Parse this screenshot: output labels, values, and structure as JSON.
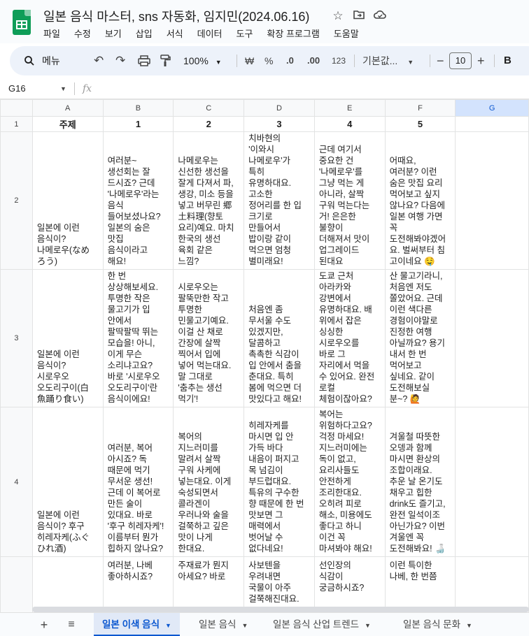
{
  "window": {
    "doc_title": "일본 음식 마스터, sns 자동화, 임지민(2024.06.16)",
    "title_icons": [
      "star-icon",
      "move-to-folder-icon",
      "cloud-status-icon"
    ]
  },
  "menu": [
    "파일",
    "수정",
    "보기",
    "삽입",
    "서식",
    "데이터",
    "도구",
    "확장 프로그램",
    "도움말"
  ],
  "toolbar": {
    "search_label": "메뉴",
    "zoom": "100%",
    "currency": "₩",
    "percent": "%",
    "decrease_decimal": ".0",
    "increase_decimal": ".00",
    "number_format": "123",
    "font": "기본값...",
    "font_size": "10",
    "plus": "+",
    "bold": "B"
  },
  "formula_bar": {
    "cell_ref": "G16",
    "fx": "fx",
    "value": ""
  },
  "columns": [
    "A",
    "B",
    "C",
    "D",
    "E",
    "F",
    "G"
  ],
  "rows": [
    {
      "num": "1",
      "cells": [
        "주제",
        "1",
        "2",
        "3",
        "4",
        "5",
        ""
      ]
    },
    {
      "num": "2",
      "cells": [
        "일본에 이런\n음식이?\n나메로우(なめ\nろう)",
        "여러분~\n생선회는 잘\n드시죠? 근데\n'나메로우'라는\n음식\n들어보셨나요?\n일본의 숨은\n맛집\n음식이라고\n해요!",
        "나메로우는\n신선한 생선을\n잘게 다져서 파,\n생강, 미소 등을\n넣고 버무린 郷\n土料理(향토\n요리)예요. 마치\n한국의 생선\n육회 같은\n느낌?",
        "치바현의\n'이와시\n나메로우'가\n특히\n유명하대요.\n고소한\n정어리를 한 입\n크기로\n만들어서\n밥이랑 같이\n먹으면 엄청\n별미래요!",
        "근데 여기서\n중요한 건\n'나메로우'를\n그냥 먹는 게\n아니라, 살짝\n구워 먹는다는\n거! 은은한\n불향이\n더해져서 맛이\n업그레이드\n된대요",
        "어때요,\n여러분? 이런\n숨은 맛집 요리\n먹어보고 싶지\n않나요? 다음에\n일본 여행 가면\n꼭\n도전해봐야겠어\n요. 벌써부터 침\n고이네요 🤤",
        ""
      ]
    },
    {
      "num": "3",
      "cells": [
        "일본에 이런\n음식이?\n시로우오\n오도리구이(白\n魚踊り食い)",
        "한 번\n상상해보세요.\n투명한 작은\n물고기가 입\n안에서\n팔딱팔딱 뛰는\n모습을! 아니,\n이게 무슨\n소리냐고요?\n바로 '시로우오\n오도리구이'란\n음식이에요!",
        "시로우오는\n팔뚝만한 작고\n투명한\n민물고기예요.\n이걸 산 채로\n간장에 살짝\n찍어서 입에\n넣어 먹는대요.\n말 그대로\n'춤추는 생선\n먹기'!",
        "처음엔 좀\n무서울 수도\n있겠지만,\n달콤하고\n촉촉한 식감이\n입 안에서 춤을\n춘대요. 특히\n봄에 먹으면 더\n맛있다고 해요!",
        "도쿄 근처\n아라카와\n강변에서\n유명하대요. 배\n위에서 잡은\n싱싱한\n시로우오를\n바로 그\n자리에서 먹을\n수 있어요. 완전\n로컬\n체험이잖아요?",
        "산 물고기라니,\n처음엔 저도\n쫄았어요. 근데\n이런 색다른\n경험이야말로\n진정한 여행\n아닐까요? 용기\n내서 한 번\n먹어보고\n싶네요. 같이\n도전해보실\n분~? 🙋",
        ""
      ]
    },
    {
      "num": "4",
      "cells": [
        "일본에 이런\n음식이? 후구\n히레자케(ふぐ\nひれ酒)",
        "여러분, 복어\n아시죠? 독\n때문에 먹기\n무서운 생선!\n근데 이 복어로\n만든 술이\n있대요. 바로\n'후구 히레자케'!\n이름부터 뭔가\n힙하지 않나요?",
        "복어의\n지느러미를\n말려서 살짝\n구워 사케에\n넣는대요. 이게\n숙성되면서\n콜라겐이\n우러나와 술을\n걸쭉하고 깊은\n맛이 나게\n한대요.",
        "히레자케를\n마시면 입 안\n가득 바다\n내음이 퍼지고\n목 넘김이\n부드럽대요.\n특유의 구수한\n향 때문에 한 번\n맛보면 그\n매력에서\n벗어날 수\n없다네요!",
        "복어는\n위험하다고요?\n걱정 마세요!\n지느러미에는\n독이 없고,\n요리사들도\n안전하게\n조리한대요.\n오히려 피로\n해소, 미용에도\n좋다고 하니\n이건 꼭\n마셔봐야 해요!",
        "겨울철 따뜻한\n오뎅과 함께\n마시면 환상의\n조합이래요.\n추운 날 온기도\n채우고 힙한\ndrink도 즐기고,\n완전 일석이조\n아닌가요? 이번\n겨울엔 꼭\n도전해봐요! 🍶",
        ""
      ]
    },
    {
      "num": "",
      "cells": [
        "",
        "여러분, 나베\n좋아하시죠?",
        "주재료가 뭔지\n아세요? 바로",
        "사보텐을\n우려내면\n국물이 아주\n걸쭉해진대요.",
        "선인장의\n식감이\n궁금하시죠?",
        "이런 특이한\n나베, 한 번쯤",
        ""
      ]
    }
  ],
  "sheet_tabs": {
    "add": "+",
    "all_sheets": "≡",
    "tabs": [
      "일본 이색 음식",
      "일본 음식",
      "일본 음식 산업 트렌드",
      "일본 음식 문화"
    ]
  },
  "colors": {
    "accent": "#0b57d0",
    "selected_col": "#d3e3fd",
    "toolbar_bg": "#edf2fa",
    "sheets_green": "#0f9d58"
  }
}
